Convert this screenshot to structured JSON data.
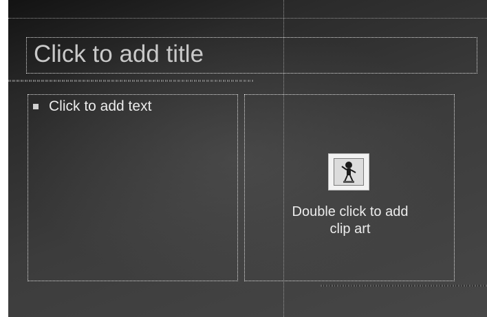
{
  "slide": {
    "title_placeholder": "Click to add title",
    "text_placeholder": "Click to add text",
    "clipart_placeholder_line1": "Double click to add",
    "clipart_placeholder_line2": "clip art",
    "clipart_icon": "clip-art-icon"
  },
  "colors": {
    "background_dark": "#131313",
    "background_light": "#474747",
    "placeholder_border": "#e6e6e6",
    "title_text": "#c9c9c9",
    "body_text": "#ececec"
  }
}
